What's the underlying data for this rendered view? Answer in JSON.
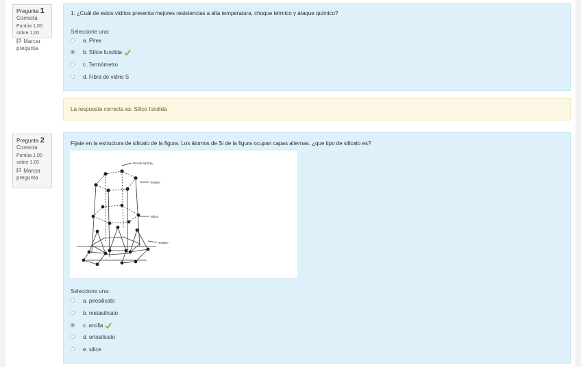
{
  "questions": [
    {
      "info": {
        "label": "Pregunta",
        "number": "1",
        "state": "Correcta",
        "grade_line1": "Puntúa 1,00",
        "grade_line2": "sobre 1,00",
        "flag_label_line1": "Marcar",
        "flag_label_line2": "pregunta"
      },
      "text": "1. ¿Cuál de estos vidrios presenta mejores resistencias a alta temperatura, choque térmico y ataque químico?",
      "prompt": "Seleccione una:",
      "answers": [
        {
          "label": "a. Pirex",
          "checked": false,
          "correct": false
        },
        {
          "label": "b. Sílice fundida",
          "checked": true,
          "correct": true
        },
        {
          "label": "c. Termómetro",
          "checked": false,
          "correct": false
        },
        {
          "label": "d. Fibra de vidrio S",
          "checked": false,
          "correct": false
        }
      ],
      "feedback": "La respuesta correcta es: Sílice fundida"
    },
    {
      "info": {
        "label": "Pregunta",
        "number": "2",
        "state": "Correcta",
        "grade_line1": "Puntúa 1,00",
        "grade_line2": "sobre 1,00",
        "flag_label_line1": "Marcar",
        "flag_label_line2": "pregunta"
      },
      "text": "Fíjate en la estructura de silicato de la figura. Los átomos de Si de la figura ocupan capas alternas. ¿que tipo de silicato es?",
      "figure_labels": [
        "OH de Al(OH)₃",
        "Enlace",
        "Sílice",
        "Enlace"
      ],
      "prompt": "Seleccione una:",
      "answers": [
        {
          "label": "a. pirosilicato",
          "checked": false,
          "correct": false
        },
        {
          "label": "b. metasilicato",
          "checked": false,
          "correct": false
        },
        {
          "label": "c. arcilla",
          "checked": true,
          "correct": true
        },
        {
          "label": "d. ortosilicato",
          "checked": false,
          "correct": false
        },
        {
          "label": "e. silice",
          "checked": false,
          "correct": false
        }
      ]
    }
  ],
  "colors": {
    "question_bg": "#def0f9",
    "feedback_bg": "#fcf8e3",
    "tick": "#7cba2d"
  }
}
